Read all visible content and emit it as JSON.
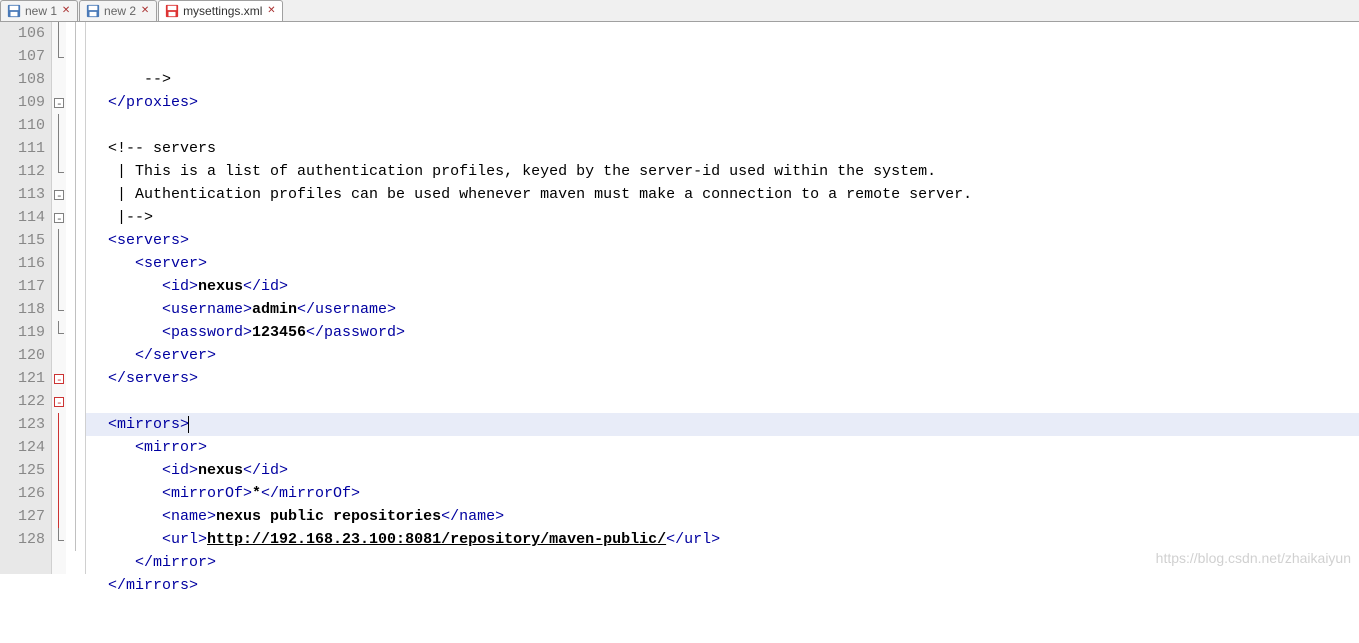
{
  "tabs": [
    {
      "label": "new 1",
      "icon": "disk-blue",
      "active": false
    },
    {
      "label": "new 2",
      "icon": "disk-blue",
      "active": false
    },
    {
      "label": "mysettings.xml",
      "icon": "disk-red",
      "active": true
    }
  ],
  "line_start": 106,
  "highlight_line": 121,
  "lines": [
    {
      "n": 106,
      "fold": "l",
      "indent": "      ",
      "segs": [
        {
          "txt": "-->"
        }
      ]
    },
    {
      "n": 107,
      "fold": "end",
      "indent": "  ",
      "segs": [
        {
          "txt": "</proxies>",
          "cls": "t"
        }
      ]
    },
    {
      "n": 108,
      "fold": "",
      "indent": "",
      "segs": []
    },
    {
      "n": 109,
      "fold": "box",
      "indent": "  ",
      "segs": [
        {
          "txt": "<!-- servers"
        }
      ]
    },
    {
      "n": 110,
      "fold": "l",
      "indent": "   ",
      "segs": [
        {
          "txt": "| This is a list of authentication profiles, keyed by the server-id used within the system."
        }
      ]
    },
    {
      "n": 111,
      "fold": "l",
      "indent": "   ",
      "segs": [
        {
          "txt": "| Authentication profiles can be used whenever maven must make a connection to a remote server."
        }
      ]
    },
    {
      "n": 112,
      "fold": "end",
      "indent": "   ",
      "segs": [
        {
          "txt": "|-->"
        }
      ]
    },
    {
      "n": 113,
      "fold": "box",
      "indent": "  ",
      "segs": [
        {
          "txt": "<servers>",
          "cls": "t"
        }
      ]
    },
    {
      "n": 114,
      "fold": "box",
      "indent": "     ",
      "segs": [
        {
          "txt": "<server>",
          "cls": "t"
        }
      ]
    },
    {
      "n": 115,
      "fold": "l",
      "indent": "        ",
      "segs": [
        {
          "txt": "<id>",
          "cls": "t"
        },
        {
          "txt": "nexus",
          "cls": "b"
        },
        {
          "txt": "</id>",
          "cls": "t"
        }
      ]
    },
    {
      "n": 116,
      "fold": "l",
      "indent": "        ",
      "segs": [
        {
          "txt": "<username>",
          "cls": "t"
        },
        {
          "txt": "admin",
          "cls": "b"
        },
        {
          "txt": "</username>",
          "cls": "t"
        }
      ]
    },
    {
      "n": 117,
      "fold": "l",
      "indent": "        ",
      "segs": [
        {
          "txt": "<password>",
          "cls": "t"
        },
        {
          "txt": "123456",
          "cls": "b"
        },
        {
          "txt": "</password>",
          "cls": "t"
        }
      ]
    },
    {
      "n": 118,
      "fold": "end",
      "indent": "     ",
      "segs": [
        {
          "txt": "</server>",
          "cls": "t"
        }
      ]
    },
    {
      "n": 119,
      "fold": "end",
      "indent": "  ",
      "segs": [
        {
          "txt": "</servers>",
          "cls": "t"
        }
      ]
    },
    {
      "n": 120,
      "fold": "",
      "indent": "",
      "segs": []
    },
    {
      "n": 121,
      "fold": "boxred",
      "indent": "  ",
      "segs": [
        {
          "txt": "<mirrors>",
          "cls": "t"
        },
        {
          "txt": "",
          "cls": "cursor"
        }
      ]
    },
    {
      "n": 122,
      "fold": "boxred",
      "indent": "     ",
      "segs": [
        {
          "txt": "<mirror>",
          "cls": "t"
        }
      ]
    },
    {
      "n": 123,
      "fold": "lred",
      "indent": "        ",
      "segs": [
        {
          "txt": "<id>",
          "cls": "t"
        },
        {
          "txt": "nexus",
          "cls": "b"
        },
        {
          "txt": "</id>",
          "cls": "t"
        }
      ]
    },
    {
      "n": 124,
      "fold": "lred",
      "indent": "        ",
      "segs": [
        {
          "txt": "<mirrorOf>",
          "cls": "t"
        },
        {
          "txt": "*",
          "cls": "b"
        },
        {
          "txt": "</mirrorOf>",
          "cls": "t"
        }
      ]
    },
    {
      "n": 125,
      "fold": "lred",
      "indent": "        ",
      "segs": [
        {
          "txt": "<name>",
          "cls": "t"
        },
        {
          "txt": "nexus public repositories",
          "cls": "b"
        },
        {
          "txt": "</name>",
          "cls": "t"
        }
      ]
    },
    {
      "n": 126,
      "fold": "lred",
      "indent": "        ",
      "segs": [
        {
          "txt": "<url>",
          "cls": "t"
        },
        {
          "txt": "http://192.168.23.100:8081/repository/maven-public/",
          "cls": "b u"
        },
        {
          "txt": "</url>",
          "cls": "t"
        }
      ]
    },
    {
      "n": 127,
      "fold": "lred",
      "indent": "     ",
      "segs": [
        {
          "txt": "</mirror>",
          "cls": "t"
        }
      ]
    },
    {
      "n": 128,
      "fold": "end",
      "indent": "  ",
      "segs": [
        {
          "txt": "</mirrors>",
          "cls": "t"
        }
      ]
    }
  ],
  "watermark": "https://blog.csdn.net/zhaikaiyun"
}
